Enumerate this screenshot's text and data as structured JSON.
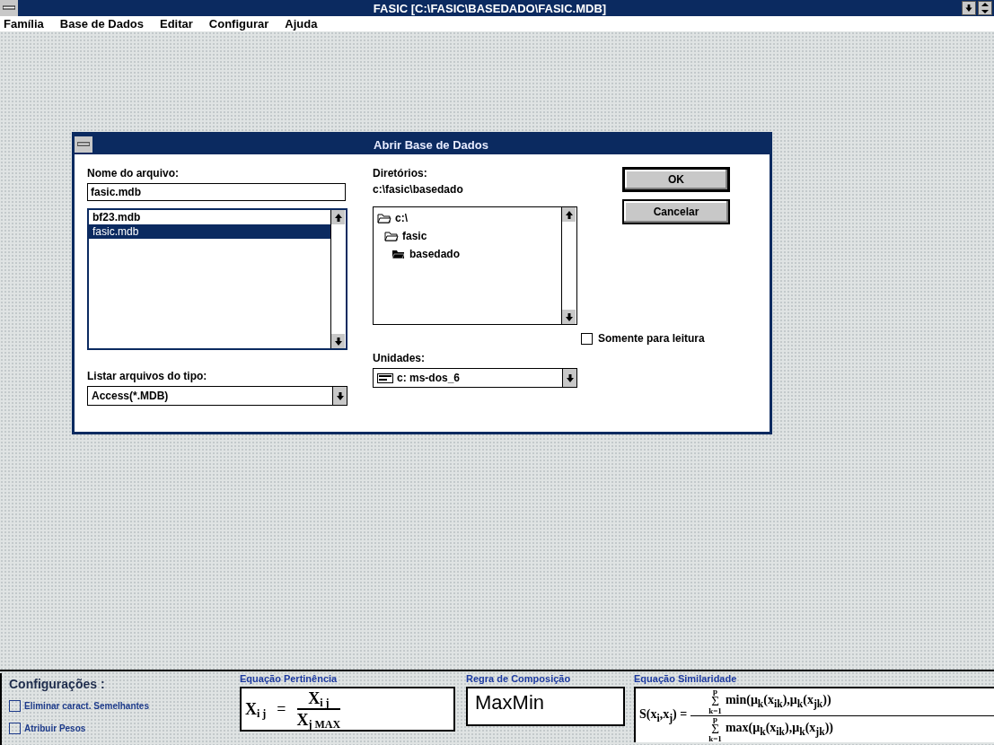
{
  "window": {
    "title": "FASIC [C:\\FASIC\\BASEDADO\\FASIC.MDB]"
  },
  "menu": [
    {
      "label": "Família"
    },
    {
      "label": "Base de Dados"
    },
    {
      "label": "Editar"
    },
    {
      "label": "Configurar"
    },
    {
      "label": "Ajuda"
    }
  ],
  "dialog": {
    "title": "Abrir Base de Dados",
    "filename": {
      "label": "Nome do arquivo:",
      "value": "fasic.mdb"
    },
    "files": [
      {
        "name": "bf23.mdb",
        "selected": false
      },
      {
        "name": "fasic.mdb",
        "selected": true
      }
    ],
    "file_type": {
      "label": "Listar arquivos do tipo:",
      "value": "Access(*.MDB)"
    },
    "directories": {
      "label": "Diretórios:",
      "path": "c:\\fasic\\basedado",
      "tree": [
        {
          "name": "c:\\",
          "current": false,
          "children": [
            {
              "name": "fasic",
              "current": false,
              "children": [
                {
                  "name": "basedado",
                  "current": true
                }
              ]
            }
          ]
        }
      ]
    },
    "drives": {
      "label": "Unidades:",
      "value": "c: ms-dos_6"
    },
    "buttons": [
      {
        "label": "OK",
        "default": true
      },
      {
        "label": "Cancelar",
        "default": false
      }
    ],
    "read_only": {
      "label": "Somente para leitura",
      "checked": false
    }
  },
  "settings": {
    "title": "Configurações :",
    "options": [
      {
        "label": "Eliminar caract. Semelhantes",
        "checked": false
      },
      {
        "label": "Atribuir Pesos",
        "checked": false
      }
    ],
    "membership": {
      "title": "Equação Pertinência",
      "lhs": "**X**$_{i j}$",
      "eq": "=",
      "numerator": "**X**$_{i j}$",
      "denominator": "**X**$_{j MAX}$"
    },
    "composition": {
      "title": "Regra de Composição",
      "value": "MaxMin"
    },
    "similarity": {
      "title": "Equação Similaridade",
      "lhs": "S(x$_{i}$,x$_{j}$) =",
      "numerator": {
        "top": "p",
        "sigma": "Σ",
        "bottom": "k=1",
        "body": "min(μ$_{k}$(x$_{ik}$),μ$_{k}$(x$_{jk}$))"
      },
      "denominator": {
        "top": "p",
        "sigma": "Σ",
        "bottom": "k=1",
        "body": "max(μ$_{k}$(x$_{ik}$),μ$_{k}$(x$_{jk}$))"
      }
    }
  }
}
